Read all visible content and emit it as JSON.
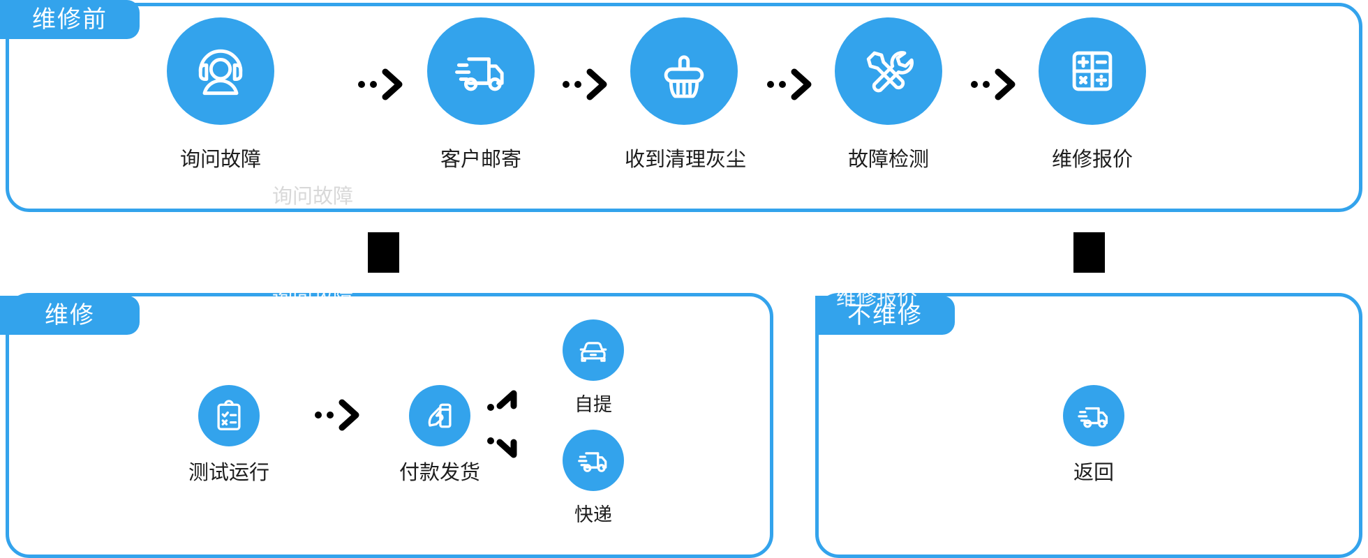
{
  "theme": {
    "accent": "#33a3ec",
    "text": "#1d1d1d",
    "badge_text": "#ffffff",
    "panel_bg": "#ffffff",
    "connector": "#000000"
  },
  "panels": [
    {
      "id": "before",
      "badge": "维修前",
      "steps": [
        {
          "label": "询问故障",
          "icon": "headset-support-icon"
        },
        {
          "label": "客户邮寄",
          "icon": "delivery-truck-icon"
        },
        {
          "label": "收到清理灰尘",
          "icon": "cleaning-brush-icon"
        },
        {
          "label": "故障检测",
          "icon": "wrench-screwdriver-icon"
        },
        {
          "label": "维修报价",
          "icon": "calculator-icon"
        }
      ],
      "connectors": [
        "dotted-chevron-arrow",
        "dotted-chevron-arrow",
        "dotted-chevron-arrow",
        "dotted-chevron-arrow"
      ]
    },
    {
      "id": "repair",
      "badge": "维修",
      "steps": [
        {
          "label": "测试运行",
          "icon": "clipboard-checklist-icon"
        },
        {
          "label": "付款发货",
          "icon": "card-payment-icon"
        }
      ],
      "branch_steps": [
        {
          "label": "自提",
          "icon": "car-front-icon"
        },
        {
          "label": "快递",
          "icon": "delivery-truck-icon"
        }
      ],
      "connectors": [
        "dotted-chevron-arrow"
      ],
      "branch_connector": "dotted-branch-arrow"
    },
    {
      "id": "norepair",
      "badge": "不维修",
      "steps": [
        {
          "label": "返回",
          "icon": "delivery-truck-icon"
        }
      ]
    }
  ],
  "artifacts": {
    "tofu_boxes": 2,
    "ghost_label_left": "询问故障",
    "ghost_label_right": "维修报价"
  }
}
